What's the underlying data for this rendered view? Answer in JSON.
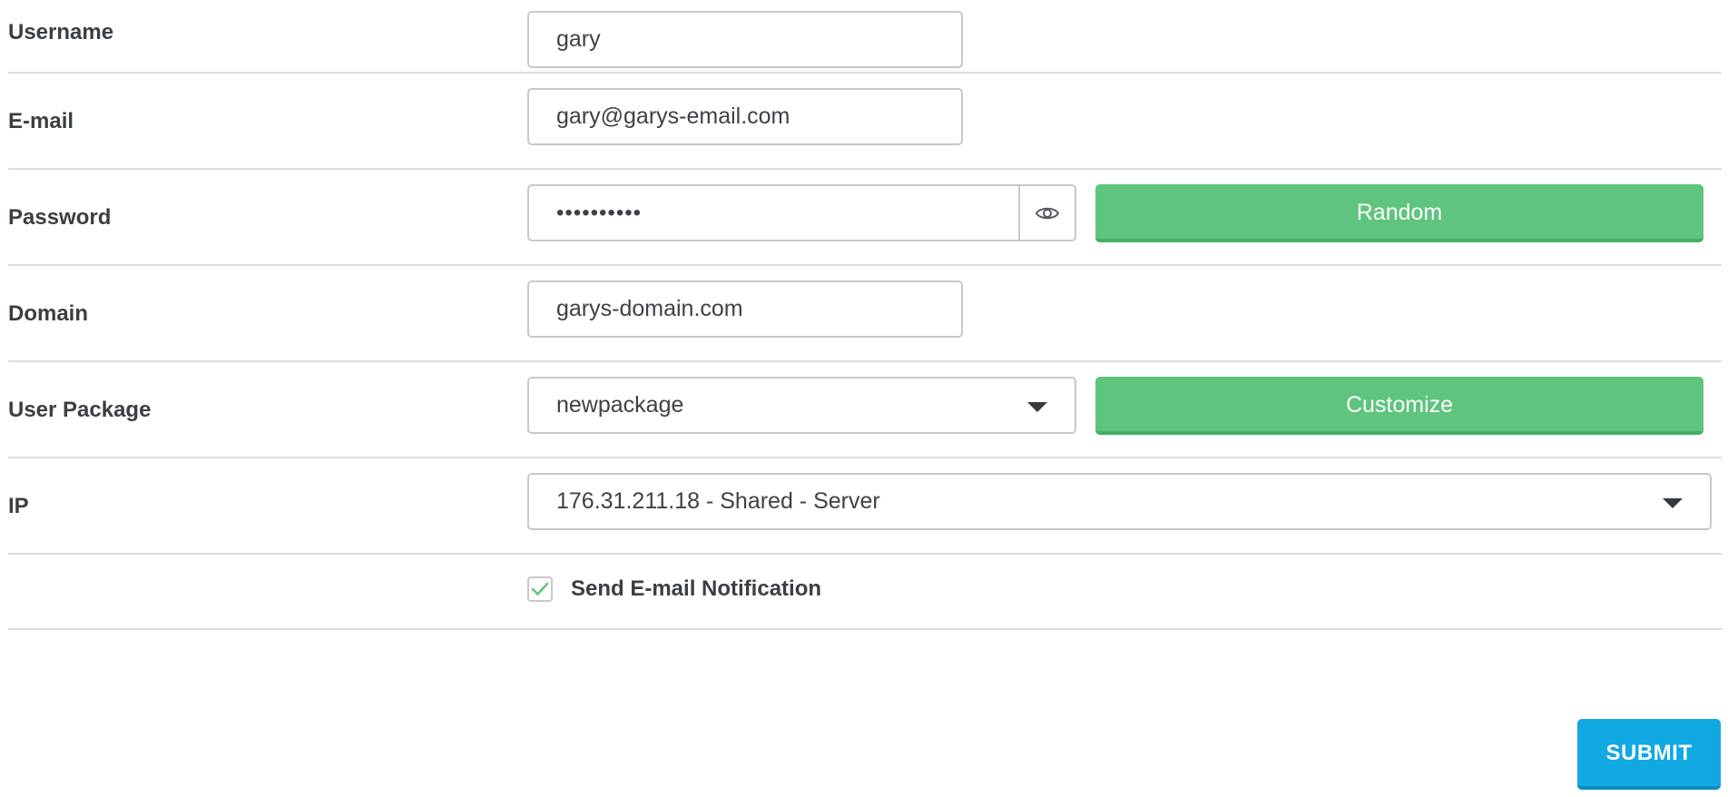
{
  "form": {
    "username": {
      "label": "Username",
      "value": "gary"
    },
    "email": {
      "label": "E-mail",
      "value": "gary@garys-email.com"
    },
    "password": {
      "label": "Password",
      "value": "••••••••••",
      "random_label": "Random"
    },
    "domain": {
      "label": "Domain",
      "value": "garys-domain.com"
    },
    "package": {
      "label": "User Package",
      "selected": "newpackage",
      "customize_label": "Customize"
    },
    "ip": {
      "label": "IP",
      "selected": "176.31.211.18 - Shared - Server"
    },
    "notify": {
      "label": "Send E-mail Notification",
      "checked": true
    },
    "submit_label": "SUBMIT"
  },
  "colors": {
    "green_button": "#5ec47e",
    "submit_button": "#12a8e2",
    "check_mark": "#5ec47e",
    "divider": "#dcdcdc"
  },
  "icons": {
    "password_toggle": "eye-icon",
    "select_caret": "caret-down-icon",
    "checkbox_mark": "check-icon"
  }
}
